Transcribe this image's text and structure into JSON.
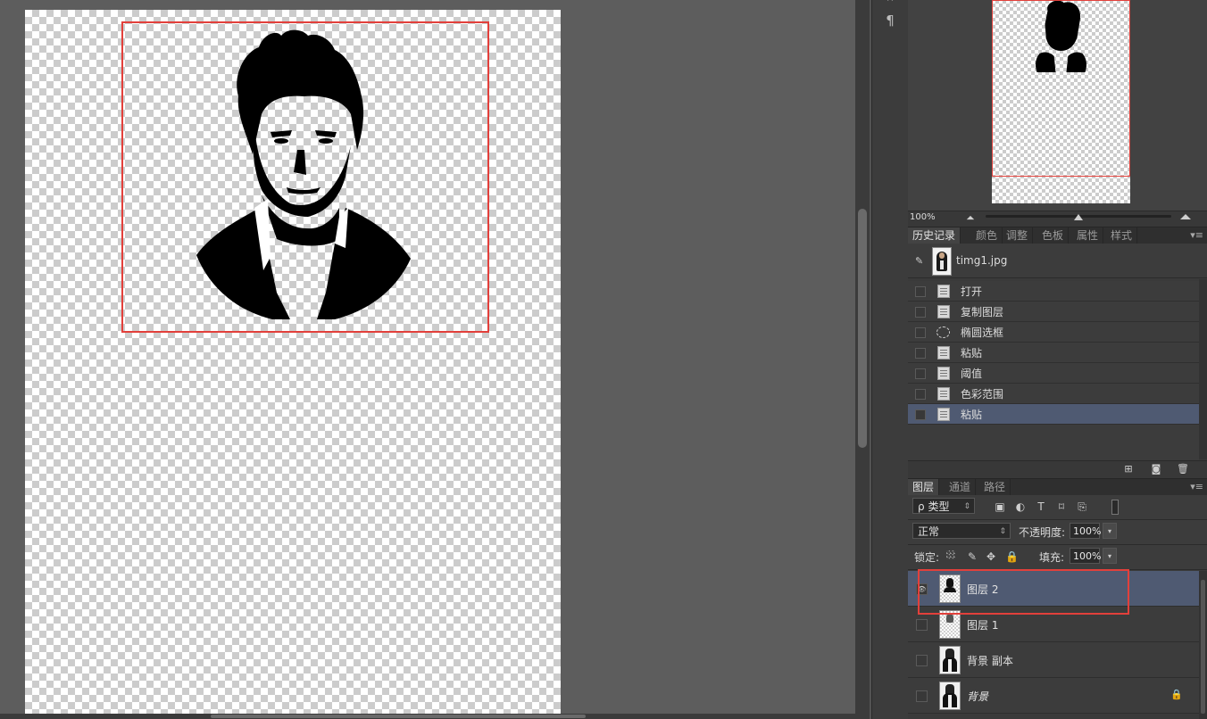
{
  "navigator": {
    "zoom": "100%"
  },
  "history_panel": {
    "tabs": [
      "历史记录",
      "颜色",
      "调整",
      "色板",
      "属性",
      "样式"
    ],
    "snapshot_label": "timg1.jpg",
    "items": [
      {
        "label": "打开",
        "icon": "document-icon"
      },
      {
        "label": "复制图层",
        "icon": "document-icon"
      },
      {
        "label": "椭圆选框",
        "icon": "ellipse-marquee-icon"
      },
      {
        "label": "粘贴",
        "icon": "document-icon"
      },
      {
        "label": "阈值",
        "icon": "document-icon"
      },
      {
        "label": "色彩范围",
        "icon": "document-icon"
      },
      {
        "label": "粘贴",
        "icon": "document-icon",
        "selected": true
      }
    ]
  },
  "layers_panel": {
    "tabs": [
      "图层",
      "通道",
      "路径"
    ],
    "filter_kind": "类型",
    "filter_prefix": "ρ",
    "blend_mode": "正常",
    "opacity_label": "不透明度:",
    "opacity_value": "100%",
    "lock_label": "锁定:",
    "fill_label": "填充:",
    "fill_value": "100%",
    "layers": [
      {
        "name": "图层 2",
        "selected": true,
        "visible": true
      },
      {
        "name": "图层 1",
        "selected": false,
        "visible": false
      },
      {
        "name": "背景 副本",
        "selected": false,
        "visible": false
      },
      {
        "name": "背景",
        "selected": false,
        "visible": false,
        "locked": true
      }
    ]
  },
  "colors": {
    "highlight_box": "#e2403b",
    "selected_row": "#4f5a72"
  }
}
